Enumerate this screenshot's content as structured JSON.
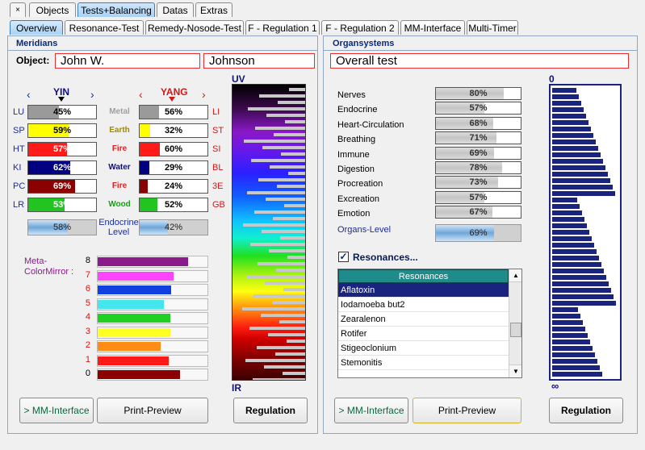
{
  "top_tabs": [
    {
      "label": "×"
    },
    {
      "label": "Objects"
    },
    {
      "label": "Tests+Balancing"
    },
    {
      "label": "Datas"
    },
    {
      "label": "Extras"
    }
  ],
  "sub_tabs": [
    {
      "label": "Overview"
    },
    {
      "label": "Resonance-Test"
    },
    {
      "label": "Remedy-Nosode-Test"
    },
    {
      "label": "F - Regulation 1"
    },
    {
      "label": "F - Regulation 2"
    },
    {
      "label": "MM-Interface"
    },
    {
      "label": "Multi-Timer"
    }
  ],
  "meridians": {
    "title": "Meridians",
    "object_label": "Object:",
    "first_name": "John W.",
    "last_name": "Johnson",
    "yin_title": "YIN",
    "yang_title": "YANG",
    "nav_left": "‹",
    "nav_right": "›",
    "yin": [
      {
        "label": "LU",
        "value": 45,
        "text": "45%",
        "color": "#9a9a9a"
      },
      {
        "label": "SP",
        "value": 59,
        "text": "59%",
        "color": "#ffff00"
      },
      {
        "label": "HT",
        "value": 57,
        "text": "57%",
        "color": "#ff1a1a"
      },
      {
        "label": "KI",
        "value": 62,
        "text": "62%",
        "color": "#000080"
      },
      {
        "label": "PC",
        "value": 69,
        "text": "69%",
        "color": "#8b0000"
      },
      {
        "label": "LR",
        "value": 53,
        "text": "53%",
        "color": "#22c422"
      }
    ],
    "elements": [
      {
        "label": "Metal",
        "color": "#a0a0a0"
      },
      {
        "label": "Earth",
        "color": "#a08a00"
      },
      {
        "label": "Fire",
        "color": "#e02020"
      },
      {
        "label": "Water",
        "color": "#10107a"
      },
      {
        "label": "Fire",
        "color": "#e02020"
      },
      {
        "label": "Wood",
        "color": "#18a018"
      }
    ],
    "yang": [
      {
        "label": "LI",
        "value": 56,
        "text": "56%",
        "color": "#9a9a9a"
      },
      {
        "label": "ST",
        "value": 32,
        "text": "32%",
        "color": "#ffff00"
      },
      {
        "label": "SI",
        "value": 60,
        "text": "60%",
        "color": "#ff1a1a"
      },
      {
        "label": "BL",
        "value": 29,
        "text": "29%",
        "color": "#000080"
      },
      {
        "label": "3E",
        "value": 24,
        "text": "24%",
        "color": "#8b0000"
      },
      {
        "label": "GB",
        "value": 52,
        "text": "52%",
        "color": "#22c422"
      }
    ],
    "yin_level": {
      "value": 58,
      "text": "58%"
    },
    "yang_level": {
      "value": 42,
      "text": "42%"
    },
    "endocrine_label_1": "Endocrine",
    "endocrine_label_2": "Level",
    "meta_label_1": "Meta-",
    "meta_label_2": "ColorMirror :",
    "color_mirror": [
      {
        "num": "8",
        "value": 82,
        "color": "#8b1a8b",
        "numcolor": "#000000"
      },
      {
        "num": "7",
        "value": 69,
        "color": "#ff44ff",
        "numcolor": "#e01010"
      },
      {
        "num": "6",
        "value": 67,
        "color": "#1040e0",
        "numcolor": "#e01010"
      },
      {
        "num": "5",
        "value": 60,
        "color": "#44e6ee",
        "numcolor": "#e01010"
      },
      {
        "num": "4",
        "value": 66,
        "color": "#22d022",
        "numcolor": "#e01010"
      },
      {
        "num": "3",
        "value": 66,
        "color": "#ffff22",
        "numcolor": "#e01010"
      },
      {
        "num": "2",
        "value": 57,
        "color": "#ff8c14",
        "numcolor": "#e01010"
      },
      {
        "num": "1",
        "value": 65,
        "color": "#ff1a1a",
        "numcolor": "#e01010"
      },
      {
        "num": "0",
        "value": 75,
        "color": "#8b0000",
        "numcolor": "#000000"
      }
    ],
    "uv_label": "UV",
    "ir_label": "IR",
    "buttons": {
      "mm": "> MM-Interface",
      "print": "Print-Preview",
      "regulation": "Regulation"
    }
  },
  "organsystems": {
    "title": "Organsystems",
    "test_name": "Overall test",
    "organs": [
      {
        "label": "Nerves",
        "value": 80,
        "text": "80%"
      },
      {
        "label": "Endocrine",
        "value": 57,
        "text": "57%"
      },
      {
        "label": "Heart-Circulation",
        "value": 68,
        "text": "68%"
      },
      {
        "label": "Breathing",
        "value": 71,
        "text": "71%"
      },
      {
        "label": "Immune",
        "value": 69,
        "text": "69%"
      },
      {
        "label": "Digestion",
        "value": 78,
        "text": "78%"
      },
      {
        "label": "Procreation",
        "value": 73,
        "text": "73%"
      },
      {
        "label": "Excreation",
        "value": 57,
        "text": "57%"
      },
      {
        "label": "Emotion",
        "value": 67,
        "text": "67%"
      }
    ],
    "organs_level_label": "Organs-Level",
    "organs_level": {
      "value": 69,
      "text": "69%"
    },
    "resonances_checkbox": "Resonances...",
    "resonances_header": "Resonances",
    "resonances": [
      "Aflatoxin",
      "Iodamoeba but2",
      "Zearalenon",
      "Rotifer",
      "Stigeoclonium",
      "Stemonitis"
    ],
    "scale_top": "0",
    "scale_bottom": "∞",
    "buttons": {
      "mm": "> MM-Interface",
      "print": "Print-Preview",
      "regulation": "Regulation"
    }
  }
}
